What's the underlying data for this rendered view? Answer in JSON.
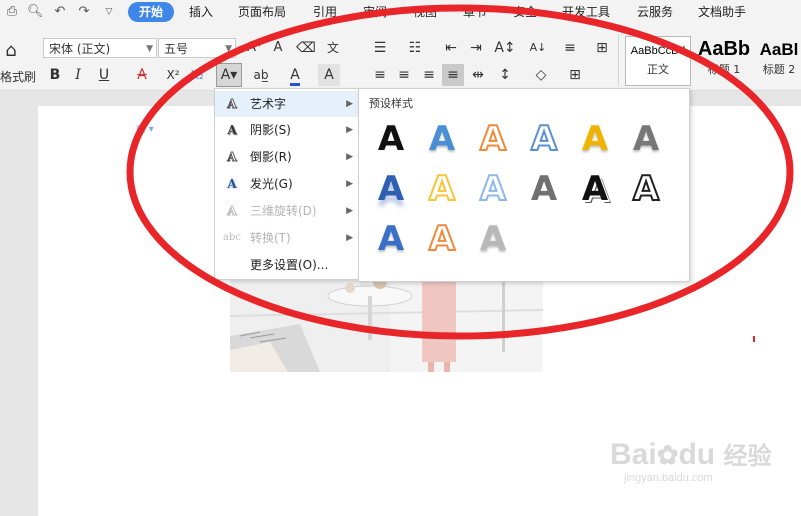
{
  "menubar": {
    "tabs": [
      {
        "label": "开始",
        "active": true
      },
      {
        "label": "插入"
      },
      {
        "label": "页面布局"
      },
      {
        "label": "引用"
      },
      {
        "label": "审阅"
      },
      {
        "label": "视图"
      },
      {
        "label": "章节"
      },
      {
        "label": "安全"
      },
      {
        "label": "开发工具"
      },
      {
        "label": "云服务"
      },
      {
        "label": "文档助手"
      }
    ]
  },
  "ribbon": {
    "format_painter_label": "格式刷",
    "font_name": "宋体 (正文)",
    "font_size": "五号",
    "bold": "B",
    "italic": "I",
    "underline": "U",
    "styles": [
      {
        "sample": "AaBbCcDd",
        "name": "正文"
      },
      {
        "sample": "AaBb",
        "name": "标题 1"
      },
      {
        "sample": "AaBl",
        "name": "标题 2"
      }
    ]
  },
  "submenu": {
    "items": [
      {
        "label": "艺术字",
        "icon": "wordart-icon",
        "glyph": "A",
        "has_submenu": true,
        "highlight": true
      },
      {
        "label": "阴影(S)",
        "icon": "shadow-icon",
        "glyph": "A",
        "has_submenu": true
      },
      {
        "label": "倒影(R)",
        "icon": "reflection-icon",
        "glyph": "A",
        "has_submenu": true
      },
      {
        "label": "发光(G)",
        "icon": "glow-icon",
        "glyph": "A",
        "has_submenu": true
      },
      {
        "label": "三维旋转(D)",
        "icon": "3d-rotation-icon",
        "glyph": "A",
        "has_submenu": true,
        "disabled": true
      },
      {
        "label": "转换(T)",
        "icon": "transform-icon",
        "glyph": "abc",
        "has_submenu": true,
        "disabled": true
      },
      {
        "label": "更多设置(O)...",
        "icon": "",
        "glyph": "",
        "has_submenu": false
      }
    ]
  },
  "preset": {
    "title": "预设样式",
    "styles_colors": [
      "#111111",
      "#4a8ed6",
      "#ef8a3c",
      "#5d8fd6",
      "#f0b400",
      "#777777",
      "#2f5fb0",
      "#f7c43a",
      "#8db8e8",
      "#707070",
      "#111111",
      "#222222",
      "#3a6fc8",
      "#ef8a3c",
      "#b8b8b8"
    ],
    "glyph": "A"
  },
  "watermark": {
    "brand": "Bai",
    "brand2": "du",
    "cn": "经验",
    "url": "jingyan.baidu.com"
  },
  "colors": {
    "accent": "#3e86e8",
    "highlight": "#e5f0fb",
    "annotation": "#e8262a"
  }
}
